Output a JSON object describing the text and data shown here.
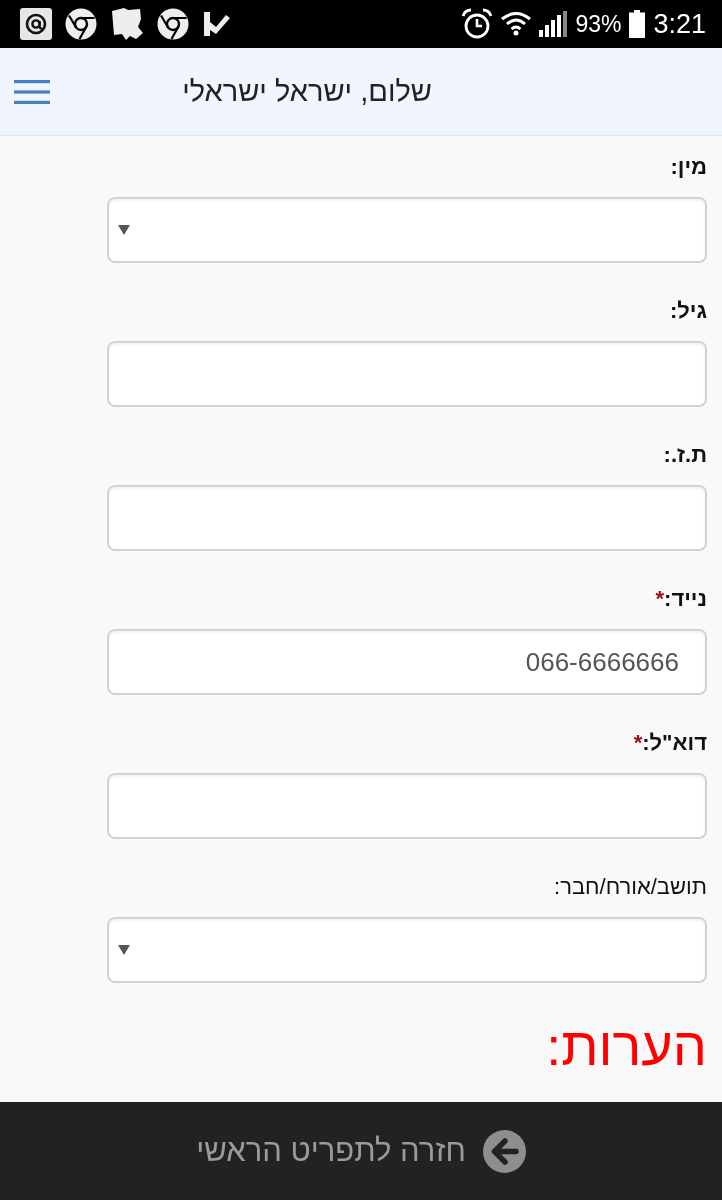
{
  "status_bar": {
    "battery_percent": "93%",
    "time": "3:21"
  },
  "header": {
    "title": "שלום, ישראל ישראלי"
  },
  "form": {
    "fields": [
      {
        "kind": "select",
        "label": "מין:",
        "bold": true
      },
      {
        "kind": "input",
        "label": "גיל:",
        "bold": true
      },
      {
        "kind": "input",
        "label": "ת.ז.:",
        "bold": true
      },
      {
        "kind": "input",
        "label": "נייד:",
        "required_mark": "*",
        "value": "066-6666666",
        "bold": true
      },
      {
        "kind": "input",
        "label": "דוא\"ל:",
        "required_mark": "*",
        "bold": true
      },
      {
        "kind": "select",
        "label": "תושב/אורח/חבר:",
        "bold": false
      }
    ]
  },
  "notes_heading": "הערות:",
  "footer": {
    "back_button": "חזרה לתפריט הראשי"
  }
}
